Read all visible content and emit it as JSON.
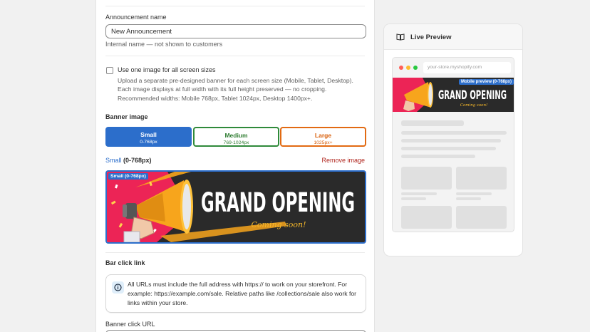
{
  "form": {
    "announcement_name_label": "Announcement name",
    "announcement_name_value": "New Announcement",
    "announcement_name_help": "Internal name — not shown to customers",
    "one_image_label": "Use one image for all screen sizes",
    "one_image_checked": false,
    "one_image_help": "Upload a separate pre-designed banner for each screen size (Mobile, Tablet, Desktop). Each image displays at full width with its full height preserved — no cropping. Recommended widths: Mobile 768px, Tablet 1024px, Desktop 1400px+.",
    "banner_image_heading": "Banner image",
    "sizes": [
      {
        "label": "Small",
        "range": "0-768px",
        "state": "selected"
      },
      {
        "label": "Medium",
        "range": "769-1024px",
        "state": "uploaded"
      },
      {
        "label": "Large",
        "range": "1025px+",
        "state": "missing"
      }
    ],
    "current_size_name": "Small",
    "current_size_range": "(0-768px)",
    "remove_image_label": "Remove image",
    "banner_preview_tag": "Small (0-768px)",
    "banner_headline": "GRAND OPENING",
    "banner_subline": "Coming soon!",
    "bar_click_heading": "Bar click link",
    "bar_click_info": "All URLs must include the full address with https:// to work on your storefront. For example: https://example.com/sale. Relative paths like /collections/sale also work for links within your store.",
    "banner_click_url_label": "Banner click URL"
  },
  "preview": {
    "title": "Live Preview",
    "icon": "book-open-icon",
    "url_placeholder": "your-store.myshopify.com",
    "mobile_tag": "Mobile preview (0-768px)",
    "banner_headline": "GRAND OPENING",
    "banner_subline": "Coming soon!"
  },
  "colors": {
    "accent": "#2c6ecb",
    "medium_border": "#2f8a3a",
    "large_border": "#e26a12",
    "remove": "#b0251d",
    "banner_pink": "#ec2456",
    "banner_dark": "#2a2a2a",
    "megaphone": "#f7a51c"
  }
}
